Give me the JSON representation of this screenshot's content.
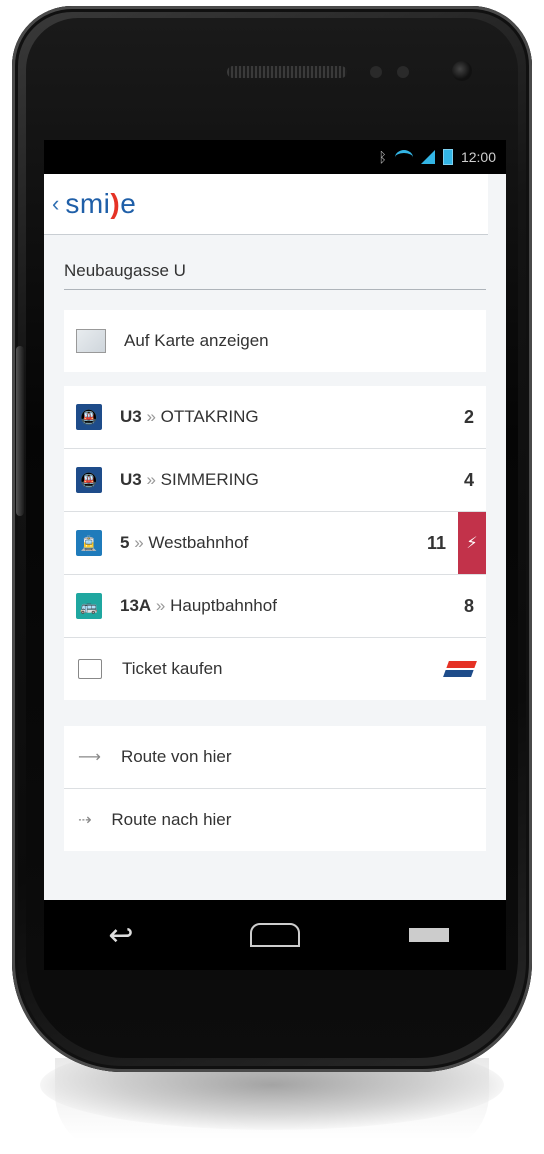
{
  "status_bar": {
    "time": "12:00"
  },
  "header": {
    "logo_pre": "smi",
    "logo_mark": ")",
    "logo_post": "e"
  },
  "station": {
    "name": "Neubaugasse U"
  },
  "map": {
    "label": "Auf Karte anzeigen"
  },
  "departures": [
    {
      "line": "U3",
      "separator": "»",
      "destination": "OTTAKRING",
      "minutes": "2",
      "type": "ubahn"
    },
    {
      "line": "U3",
      "separator": "»",
      "destination": "SIMMERING",
      "minutes": "4",
      "type": "ubahn"
    },
    {
      "line": "5",
      "separator": "»",
      "destination": "Westbahnhof",
      "minutes": "11",
      "type": "tram",
      "alert_icon": "⚡"
    },
    {
      "line": "13A",
      "separator": "»",
      "destination": "Hauptbahnhof",
      "minutes": "8",
      "type": "bus"
    }
  ],
  "ticket": {
    "label": "Ticket kaufen"
  },
  "routes": {
    "from_label": "Route von hier",
    "to_label": "Route nach hier"
  },
  "colors": {
    "brand_blue": "#1f5fa8",
    "brand_red": "#e53225",
    "alert": "#c2324a",
    "status_accent": "#33b5e5"
  },
  "icons": {
    "ubahn": "🚇",
    "tram": "🚊",
    "bus": "🚌"
  }
}
